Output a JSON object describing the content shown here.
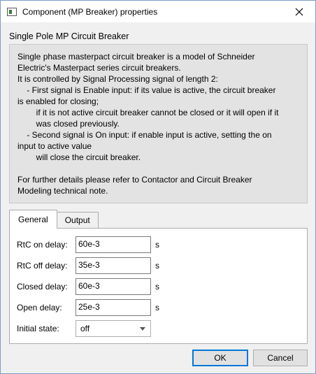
{
  "window": {
    "title": "Component (MP Breaker) properties"
  },
  "heading": "Single Pole MP Circuit Breaker",
  "description": [
    "Single phase masterpact circuit breaker is a model of Schneider",
    "Electric's Masterpact series circuit breakers.",
    "It is controlled by Signal Processing signal of length 2:",
    "    - First signal is Enable input: if its value is active, the circuit breaker",
    "is enabled for closing;",
    "        if it is not active circuit breaker cannot be closed or it will open if it",
    "        was closed previously.",
    "    - Second signal is On input: if enable input is active, setting the on",
    "input to active value",
    "        will close the circuit breaker.",
    "",
    "For further details please refer to Contactor and Circuit Breaker",
    "Modeling technical note."
  ],
  "tabs": [
    {
      "label": "General",
      "active": true
    },
    {
      "label": "Output",
      "active": false
    }
  ],
  "fields": [
    {
      "label": "RtC on delay:",
      "value": "60e-3",
      "unit": "s"
    },
    {
      "label": "RtC off delay:",
      "value": "35e-3",
      "unit": "s"
    },
    {
      "label": "Closed delay:",
      "value": "60e-3",
      "unit": "s"
    },
    {
      "label": "Open delay:",
      "value": "25e-3",
      "unit": "s"
    }
  ],
  "initial_state": {
    "label": "Initial state:",
    "value": "off"
  },
  "buttons": {
    "ok": "OK",
    "cancel": "Cancel"
  },
  "colors": {
    "accent": "#0078d7",
    "description_bg": "#e3e3e3",
    "window_bg": "#f0f0f0"
  }
}
